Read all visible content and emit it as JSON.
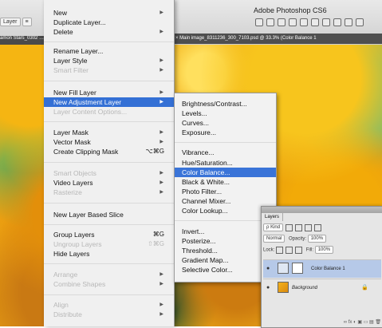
{
  "app": {
    "title": "Adobe Photoshop CS6"
  },
  "options_bar": {
    "items": [
      "Layer",
      "≡"
    ]
  },
  "document_tabs": {
    "left": "amon Stars_0302 …",
    "right": "Main image_8311236_300_7103.psd @ 33.3% (Color Balance 1"
  },
  "layer_menu": {
    "items": [
      {
        "label": "New",
        "arrow": "▶",
        "shortcut": ""
      },
      {
        "label": "Duplicate Layer...",
        "arrow": "",
        "shortcut": ""
      },
      {
        "label": "Delete",
        "arrow": "▶",
        "shortcut": ""
      },
      {
        "label": "Rename Layer...",
        "arrow": "",
        "shortcut": ""
      },
      {
        "label": "Layer Style",
        "arrow": "▶",
        "shortcut": ""
      },
      {
        "label": "Smart Filter",
        "arrow": "▶",
        "shortcut": ""
      },
      {
        "label": "New Fill Layer",
        "arrow": "▶",
        "shortcut": ""
      },
      {
        "label": "New Adjustment Layer",
        "arrow": "▶",
        "shortcut": ""
      },
      {
        "label": "Layer Content Options...",
        "arrow": "",
        "shortcut": ""
      },
      {
        "label": "Layer Mask",
        "arrow": "▶",
        "shortcut": ""
      },
      {
        "label": "Vector Mask",
        "arrow": "▶",
        "shortcut": ""
      },
      {
        "label": "Create Clipping Mask",
        "arrow": "",
        "shortcut": "⌥⌘G"
      },
      {
        "label": "Smart Objects",
        "arrow": "▶",
        "shortcut": ""
      },
      {
        "label": "Video Layers",
        "arrow": "▶",
        "shortcut": ""
      },
      {
        "label": "Rasterize",
        "arrow": "▶",
        "shortcut": ""
      },
      {
        "label": "New Layer Based Slice",
        "arrow": "",
        "shortcut": ""
      },
      {
        "label": "Group Layers",
        "arrow": "",
        "shortcut": "⌘G"
      },
      {
        "label": "Ungroup Layers",
        "arrow": "",
        "shortcut": "⇧⌘G"
      },
      {
        "label": "Hide Layers",
        "arrow": "",
        "shortcut": ""
      },
      {
        "label": "Arrange",
        "arrow": "▶",
        "shortcut": ""
      },
      {
        "label": "Combine Shapes",
        "arrow": "▶",
        "shortcut": ""
      },
      {
        "label": "Align",
        "arrow": "▶",
        "shortcut": ""
      },
      {
        "label": "Distribute",
        "arrow": "▶",
        "shortcut": ""
      }
    ]
  },
  "adjustment_submenu": {
    "items": [
      "Brightness/Contrast...",
      "Levels...",
      "Curves...",
      "Exposure...",
      "Vibrance...",
      "Hue/Saturation...",
      "Color Balance...",
      "Black & White...",
      "Photo Filter...",
      "Channel Mixer...",
      "Color Lookup...",
      "Invert...",
      "Posterize...",
      "Threshold...",
      "Gradient Map...",
      "Selective Color..."
    ]
  },
  "layers_panel": {
    "tab": "Layers",
    "kind_filter": "ρ Kind",
    "blend_mode": "Normal",
    "opacity_label": "Opacity:",
    "opacity_value": "100%",
    "lock_label": "Lock:",
    "fill_label": "Fill:",
    "fill_value": "100%",
    "layers": [
      {
        "name": "Color Balance 1",
        "selected": true
      },
      {
        "name": "Background",
        "selected": false,
        "locked": true
      }
    ],
    "footer_icons": "∞ fx ◐ ▣ ▭ ▤ 🗑"
  }
}
